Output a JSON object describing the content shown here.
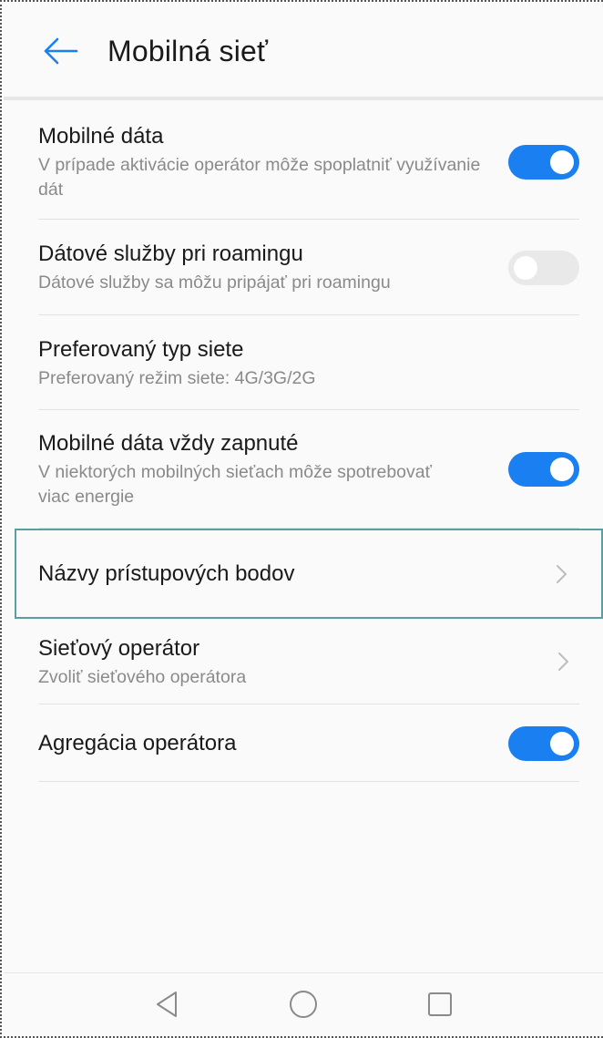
{
  "app_bar": {
    "title": "Mobilná sieť",
    "back_icon": "arrow-left-icon",
    "accent_color": "#1a7ff0"
  },
  "settings": [
    {
      "id": "mobile-data",
      "title": "Mobilné dáta",
      "subtitle": "V prípade aktivácie operátor môže spoplatniť využívanie dát",
      "control": "toggle",
      "enabled": true
    },
    {
      "id": "roaming",
      "title": "Dátové služby pri roamingu",
      "subtitle": "Dátové služby sa môžu pripájať pri roamingu",
      "control": "toggle",
      "enabled": false
    },
    {
      "id": "preferred-network",
      "title": "Preferovaný typ siete",
      "subtitle": "Preferovaný režim siete: 4G/3G/2G",
      "control": "none"
    },
    {
      "id": "always-on",
      "title": "Mobilné dáta vždy zapnuté",
      "subtitle": "V niektorých mobilných sieťach môže spotrebovať viac energie",
      "control": "toggle",
      "enabled": true
    },
    {
      "id": "apn",
      "title": "Názvy prístupových bodov",
      "subtitle": "",
      "control": "chevron",
      "highlighted": true
    },
    {
      "id": "network-operator",
      "title": "Sieťový operátor",
      "subtitle": "Zvoliť sieťového operátora",
      "control": "chevron"
    },
    {
      "id": "carrier-aggregation",
      "title": "Agregácia operátora",
      "subtitle": "",
      "control": "toggle",
      "enabled": true
    }
  ],
  "nav_bar": {
    "back_icon": "triangle-back-icon",
    "home_icon": "circle-home-icon",
    "recents_icon": "square-recents-icon"
  }
}
